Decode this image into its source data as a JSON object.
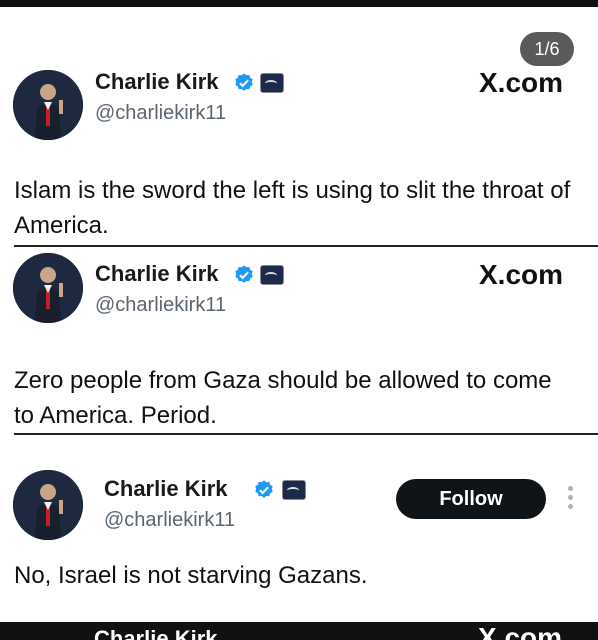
{
  "gallery": {
    "counter": "1/6"
  },
  "posts": [
    {
      "author": "Charlie Kirk",
      "handle": "@charliekirk11",
      "source": "X.com",
      "text": "Islam is the sword the left is using to slit the throat of America."
    },
    {
      "author": "Charlie Kirk",
      "handle": "@charliekirk11",
      "source": "X.com",
      "text": "Zero people from Gaza should be allowed to come to America. Period."
    },
    {
      "author": "Charlie Kirk",
      "handle": "@charliekirk11",
      "follow_label": "Follow",
      "text": "No, Israel is not starving Gazans."
    },
    {
      "author": "Charlie Kirk",
      "source": "X.com"
    }
  ],
  "colors": {
    "verified": "#1d9bf0",
    "follow_bg": "#0f1419",
    "counter_bg": "#5a5a5a"
  },
  "icons": [
    "verified-badge-icon",
    "affiliation-badge-icon",
    "more-options-icon"
  ]
}
